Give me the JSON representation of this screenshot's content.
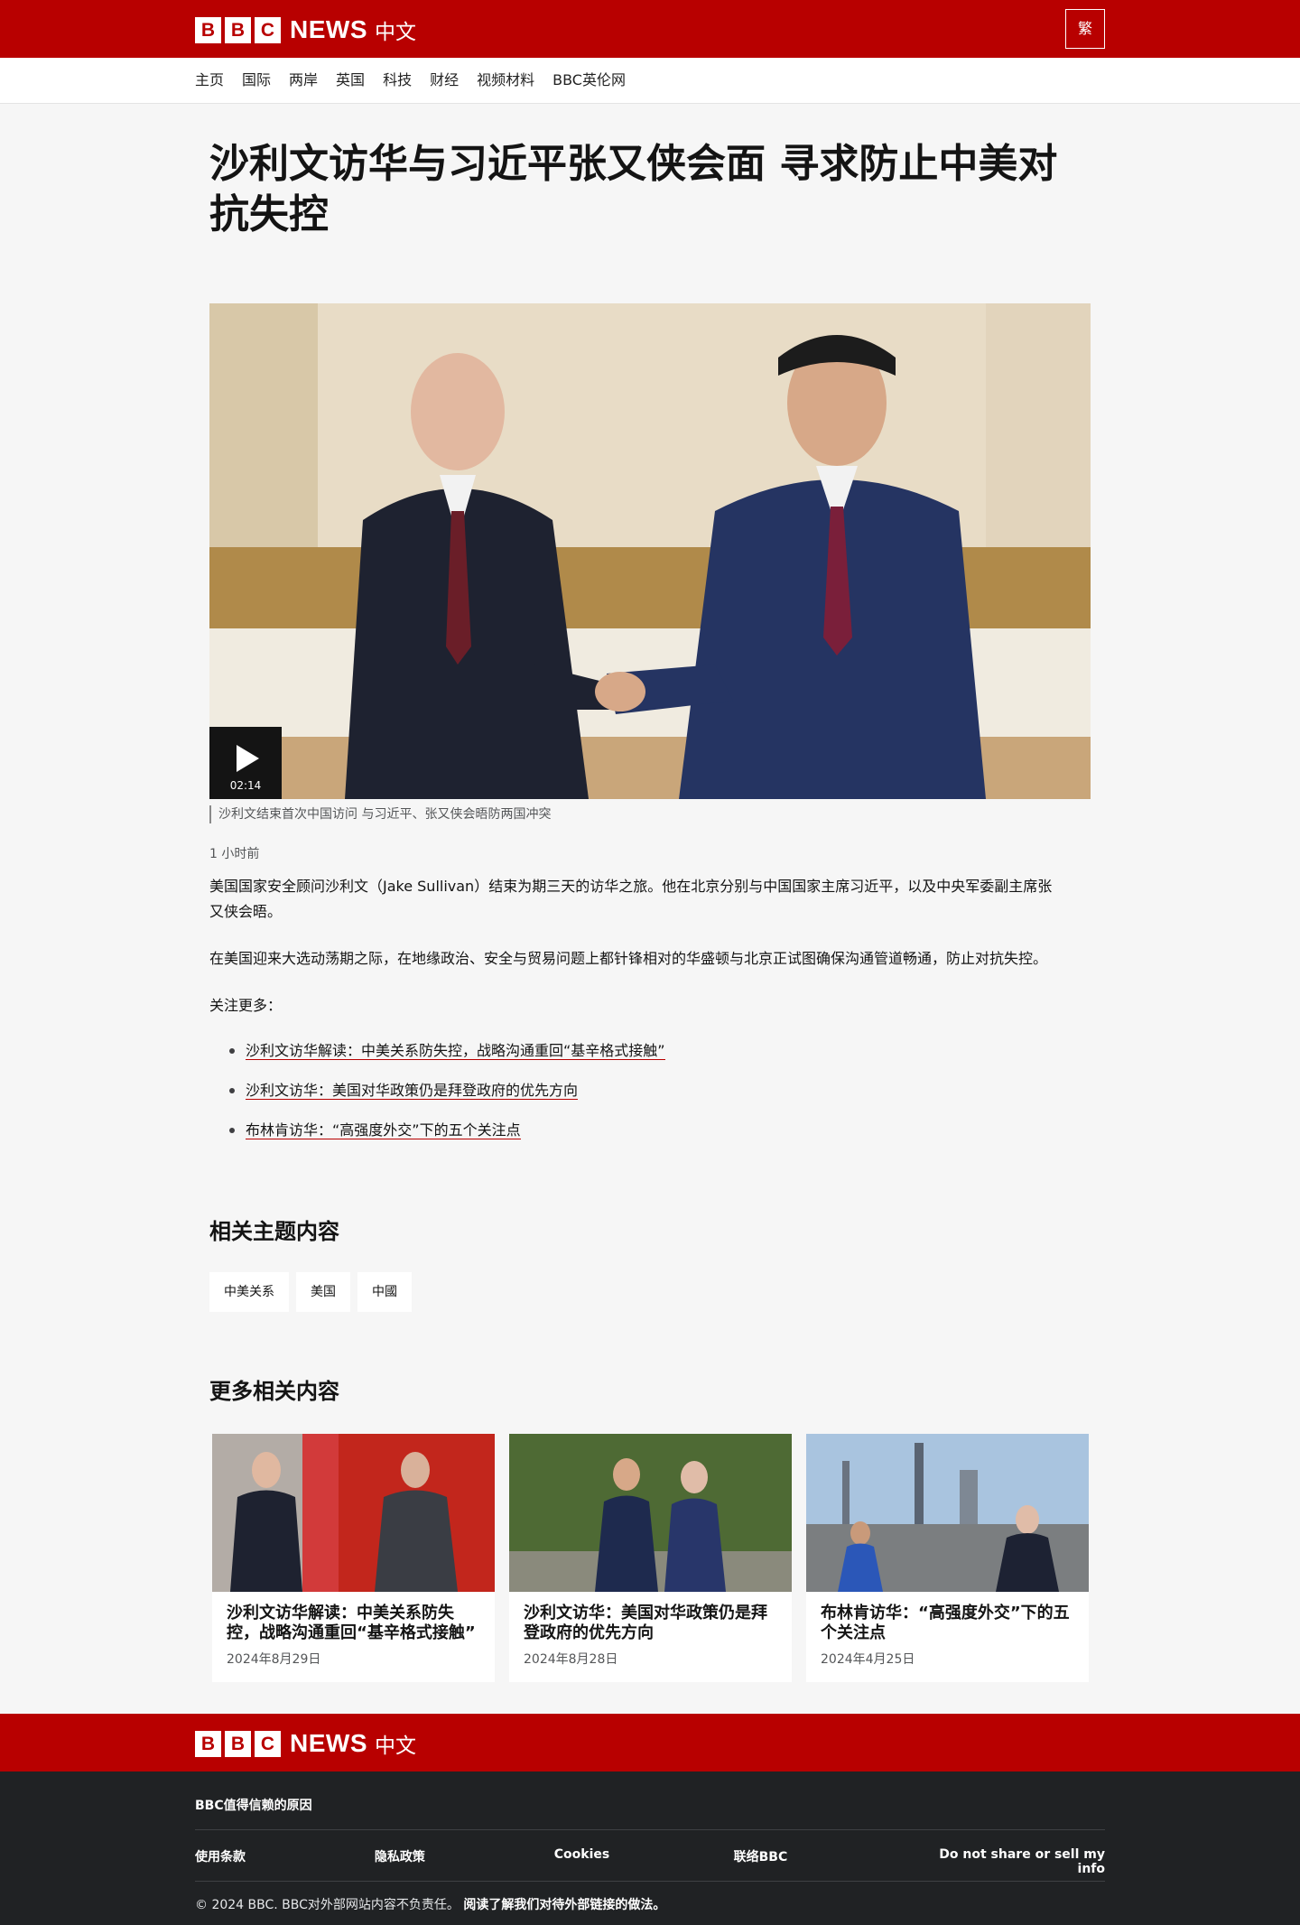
{
  "header": {
    "logo_letters": [
      "B",
      "B",
      "C"
    ],
    "logo_news": "NEWS",
    "logo_zh": "中文",
    "trad_button": "繁"
  },
  "nav": {
    "items": [
      "主页",
      "国际",
      "两岸",
      "英国",
      "科技",
      "财经",
      "视频材料",
      "BBC英伦网"
    ]
  },
  "article": {
    "headline": "沙利文访华与习近平张又侠会面 寻求防止中美对抗失控",
    "video_duration": "02:14",
    "caption": "沙利文结束首次中国访问 与习近平、张又侠会晤防两国冲突",
    "timestamp": "1 小时前",
    "para1": "美国国家安全顾问沙利文（Jake Sullivan）结束为期三天的访华之旅。他在北京分别与中国国家主席习近平，以及中央军委副主席张又侠会晤。",
    "para2": "在美国迎来大选动荡期之际，在地缘政治、安全与贸易问题上都针锋相对的华盛顿与北京正试图确保沟通管道畅通，防止对抗失控。",
    "para3": "关注更多：",
    "links": [
      "沙利文访华解读：中美关系防失控，战略沟通重回“基辛格式接触”",
      "沙利文访华：美国对华政策仍是拜登政府的优先方向",
      "布林肯访华：“高强度外交”下的五个关注点"
    ]
  },
  "related_topics": {
    "title": "相关主题内容",
    "tags": [
      "中美关系",
      "美国",
      "中國"
    ]
  },
  "more": {
    "title": "更多相关内容",
    "cards": [
      {
        "title": "沙利文访华解读：中美关系防失控，战略沟通重回“基辛格式接触”",
        "date": "2024年8月29日"
      },
      {
        "title": "沙利文访华：美国对华政策仍是拜登政府的优先方向",
        "date": "2024年8月28日"
      },
      {
        "title": "布林肯访华：“高强度外交”下的五个关注点",
        "date": "2024年4月25日"
      }
    ]
  },
  "footer": {
    "logo_letters": [
      "B",
      "B",
      "C"
    ],
    "logo_news": "NEWS",
    "logo_zh": "中文",
    "trust": "BBC值得信赖的原因",
    "links": [
      "使用条款",
      "隐私政策",
      "Cookies",
      "联络BBC",
      "Do not share or sell my info"
    ],
    "copyright": "© 2024 BBC. BBC对外部网站内容不负责任。",
    "external_link": "阅读了解我们对待外部链接的做法。"
  },
  "colors": {
    "brand_red": "#b80000",
    "footer_dark": "#202224",
    "page_bg": "#f6f6f6"
  }
}
